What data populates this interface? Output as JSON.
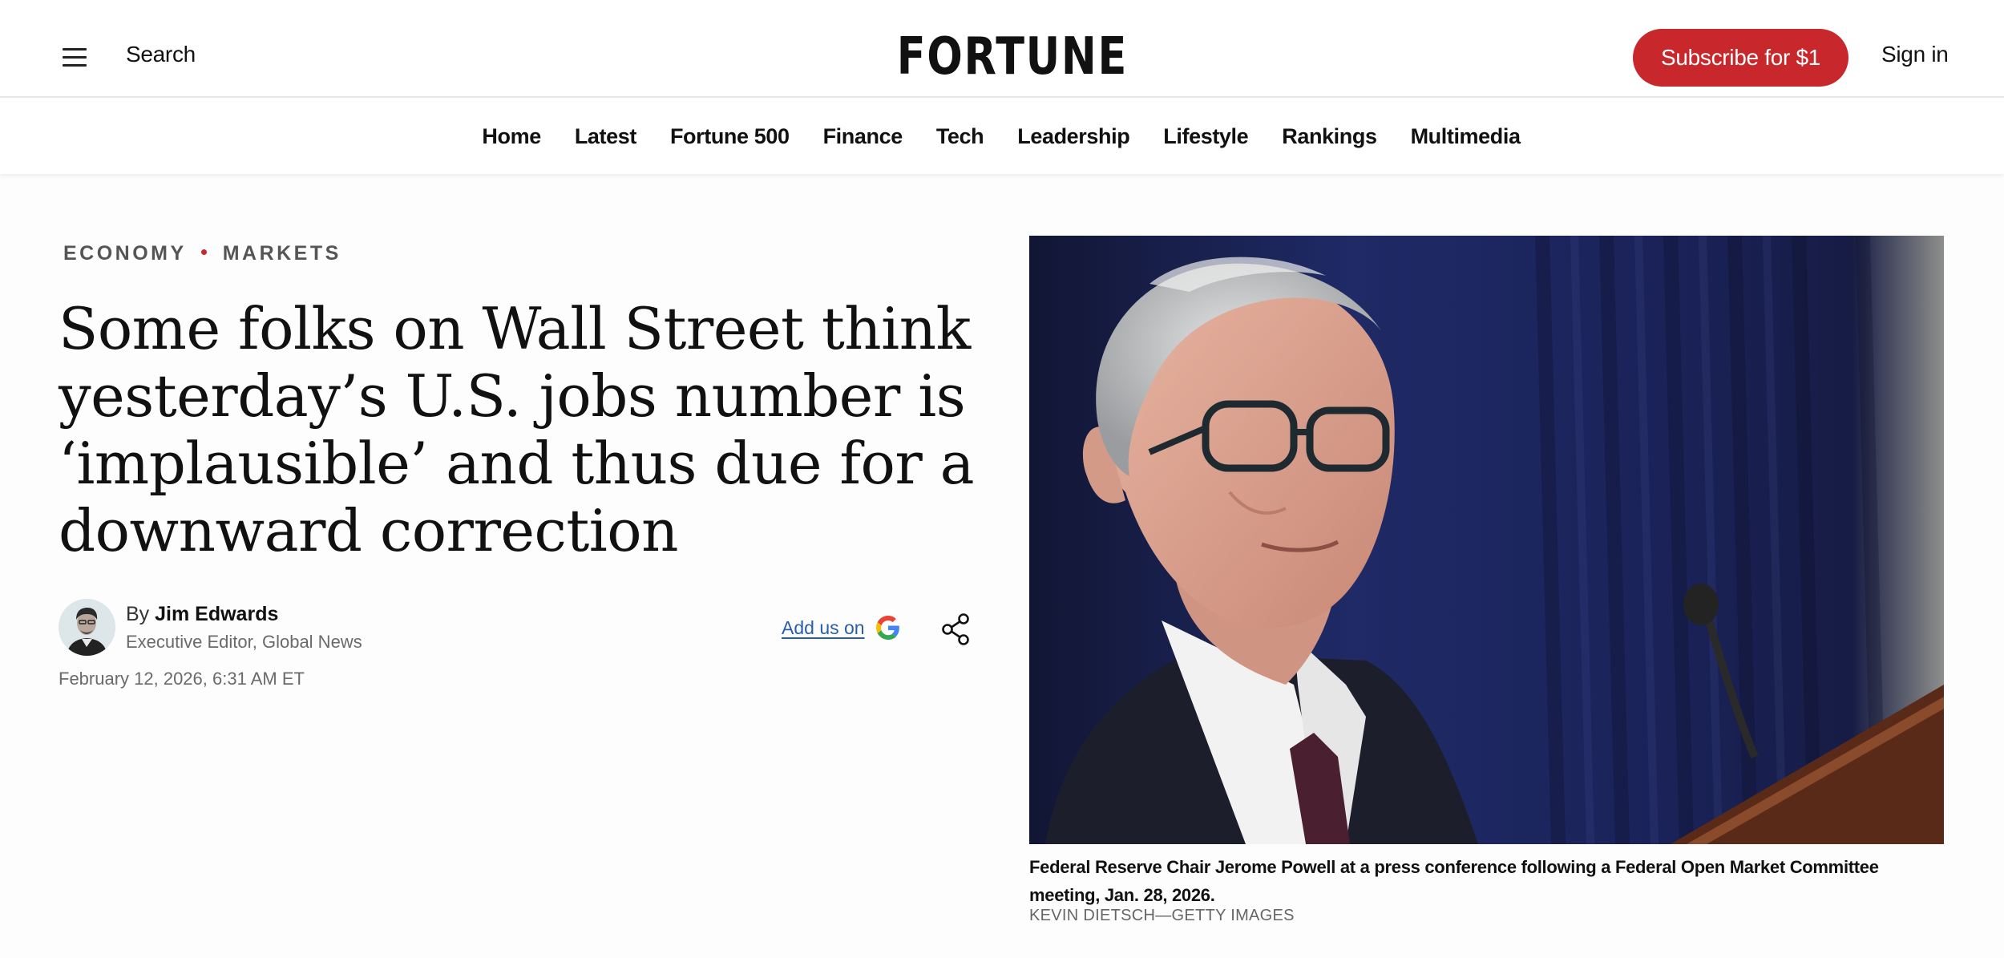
{
  "header": {
    "search_label": "Search",
    "logo_text": "FORTUNE",
    "subscribe_label": "Subscribe for $1",
    "signin_label": "Sign in"
  },
  "nav": {
    "items": [
      {
        "label": "Home"
      },
      {
        "label": "Latest"
      },
      {
        "label": "Fortune 500"
      },
      {
        "label": "Finance"
      },
      {
        "label": "Tech"
      },
      {
        "label": "Leadership"
      },
      {
        "label": "Lifestyle"
      },
      {
        "label": "Rankings"
      },
      {
        "label": "Multimedia"
      }
    ]
  },
  "article": {
    "kicker": {
      "primary": "ECONOMY",
      "secondary": "MARKETS"
    },
    "headline": "Some folks on Wall Street think yesterday’s U.S. jobs number is ‘implausible’ and thus due for a downward correction",
    "byline_prefix": "By",
    "author_name": "Jim Edwards",
    "author_title": "Executive Editor, Global News",
    "published": "February 12, 2026, 6:31 AM ET",
    "add_us_label": "Add us on",
    "image_caption": "Federal Reserve Chair Jerome Powell at a press conference following a Federal Open Market Committee meeting, Jan. 28, 2026.",
    "image_credit": "KEVIN DIETSCH—GETTY IMAGES"
  },
  "colors": {
    "brand_red": "#c8282b",
    "link_blue": "#2a5fa8",
    "curtain_navy": "#1d2350"
  },
  "icons": {
    "menu": "hamburger-menu-icon",
    "google": "google-g-icon",
    "share": "share-icon"
  }
}
